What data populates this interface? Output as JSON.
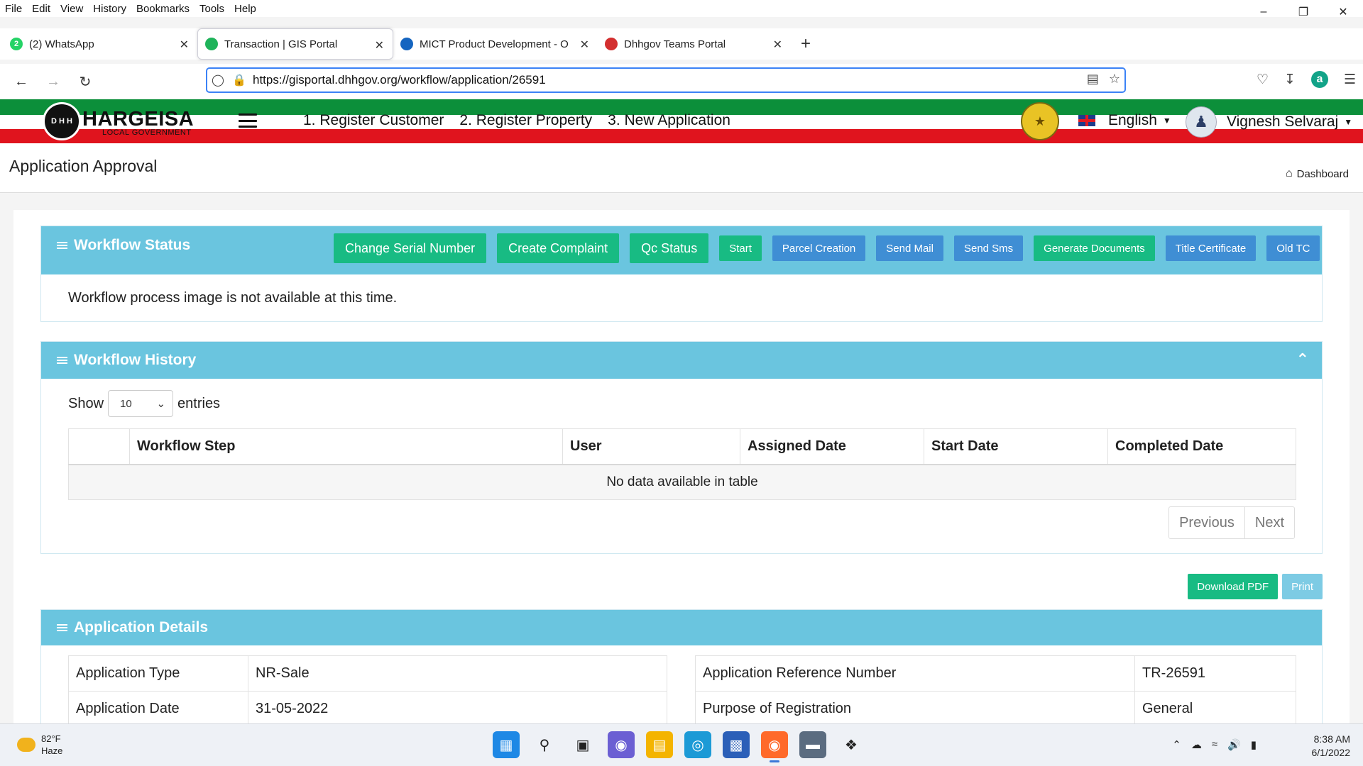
{
  "browser": {
    "menu": [
      "File",
      "Edit",
      "View",
      "History",
      "Bookmarks",
      "Tools",
      "Help"
    ],
    "tabs": [
      {
        "label": "(2) WhatsApp",
        "badge": "2",
        "color": "#25d366"
      },
      {
        "label": "Transaction | GIS Portal",
        "color": "#1fb35a"
      },
      {
        "label": "MICT Product Development - O",
        "color": "#1565c0"
      },
      {
        "label": "Dhhgov Teams Portal",
        "color": "#d32f2f"
      }
    ],
    "url": "https://gisportal.dhhgov.org/workflow/application/26591"
  },
  "site": {
    "logo_title": "HARGEISA",
    "logo_sub": "LOCAL GOVERNMENT",
    "logo_emblem": "D H H",
    "nav": [
      "1. Register Customer",
      "2. Register Property",
      "3. New Application"
    ],
    "language": "English",
    "user": "Vignesh Selvaraj",
    "colors": {
      "green": "#0c8f3a",
      "red": "#e0141e"
    }
  },
  "page": {
    "title": "Application Approval",
    "breadcrumb": "Dashboard"
  },
  "workflow_status": {
    "title": "Workflow Status",
    "buttons_big": [
      "Change Serial Number",
      "Create Complaint",
      "Qc Status"
    ],
    "buttons_small": [
      {
        "label": "Start",
        "color": "green"
      },
      {
        "label": "Parcel Creation",
        "color": "blue"
      },
      {
        "label": "Send Mail",
        "color": "blue"
      },
      {
        "label": "Send Sms",
        "color": "blue"
      },
      {
        "label": "Generate Documents",
        "color": "green"
      },
      {
        "label": "Title Certificate",
        "color": "blue"
      },
      {
        "label": "Old TC",
        "color": "blue"
      }
    ],
    "message": "Workflow process image is not available at this time."
  },
  "workflow_history": {
    "title": "Workflow History",
    "show_label": "Show",
    "entries_label": "entries",
    "page_size": "10",
    "columns": [
      "",
      "Workflow Step",
      "User",
      "Assigned Date",
      "Start Date",
      "Completed Date"
    ],
    "empty_text": "No data available in table",
    "previous": "Previous",
    "next": "Next"
  },
  "actions": {
    "download_pdf": "Download PDF",
    "print": "Print"
  },
  "application_details": {
    "title": "Application Details",
    "left": [
      {
        "label": "Application Type",
        "value": "NR-Sale"
      },
      {
        "label": "Application Date",
        "value": "31-05-2022"
      }
    ],
    "right": [
      {
        "label": "Application Reference Number",
        "value": "TR-26591"
      },
      {
        "label": "Purpose of Registration",
        "value": "General"
      }
    ]
  },
  "taskbar": {
    "temp": "82°F",
    "weather": "Haze",
    "time": "8:38 AM",
    "date": "6/1/2022"
  }
}
